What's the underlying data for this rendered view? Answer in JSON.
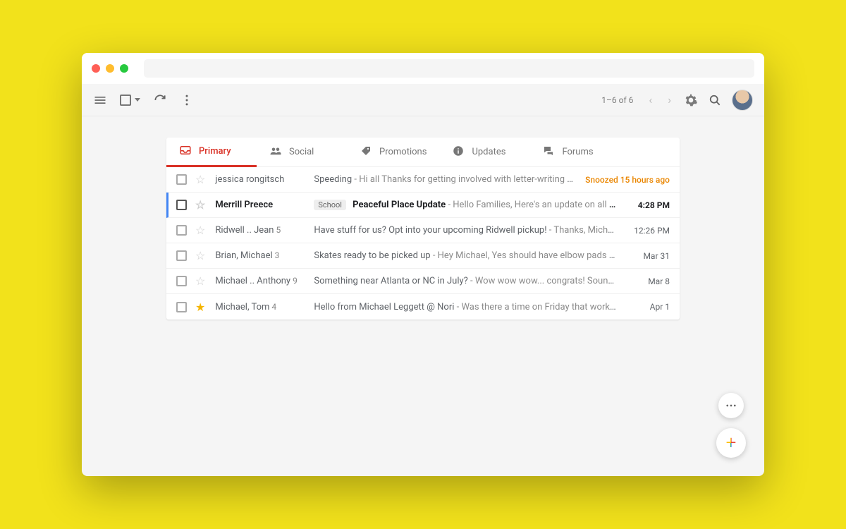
{
  "toolbar": {
    "pager": "1–6 of 6"
  },
  "tabs": [
    {
      "label": "Primary",
      "active": true,
      "icon": "inbox"
    },
    {
      "label": "Social",
      "active": false,
      "icon": "people"
    },
    {
      "label": "Promotions",
      "active": false,
      "icon": "tag"
    },
    {
      "label": "Updates",
      "active": false,
      "icon": "info"
    },
    {
      "label": "Forums",
      "active": false,
      "icon": "forum"
    }
  ],
  "emails": [
    {
      "sender": "jessica rongitsch",
      "count": "",
      "labels": [],
      "subject": "Speeding",
      "preview": "Hi all Thanks for getting involved with letter-writing to see if it hel…",
      "date": "Snoozed 15 hours ago",
      "snoozed": true,
      "unread": false,
      "starred": false
    },
    {
      "sender": "Merrill Preece",
      "count": "",
      "labels": [
        "School"
      ],
      "subject": "Peaceful Place Update",
      "preview": "Hello Families, Here's an update on all we've been up to…",
      "date": "4:28 PM",
      "snoozed": false,
      "unread": true,
      "starred": false
    },
    {
      "sender": "Ridwell .. Jean",
      "count": "5",
      "labels": [],
      "subject": "Have stuff for us? Opt into your upcoming Ridwell pickup!",
      "preview": "Thanks, Michael, I had forgot…",
      "date": "12:26 PM",
      "snoozed": false,
      "unread": false,
      "starred": false
    },
    {
      "sender": "Brian, Michael",
      "count": "3",
      "labels": [],
      "subject": "Skates ready to be picked up",
      "preview": "Hey Michael, Yes should have elbow pads and knee pads, …",
      "date": "Mar 31",
      "snoozed": false,
      "unread": false,
      "starred": false
    },
    {
      "sender": "Michael .. Anthony",
      "count": "9",
      "labels": [],
      "subject": "Something near Atlanta or NC in July?",
      "preview": "Wow wow wow... congrats! Sounds like you're pl…",
      "date": "Mar 8",
      "snoozed": false,
      "unread": false,
      "starred": false
    },
    {
      "sender": "Michael, Tom",
      "count": "4",
      "labels": [],
      "subject": "Hello from Michael Leggett @ Nori",
      "preview": "Was there a time on Friday that works for you?",
      "date": "Apr 1",
      "snoozed": false,
      "unread": false,
      "starred": true
    }
  ]
}
